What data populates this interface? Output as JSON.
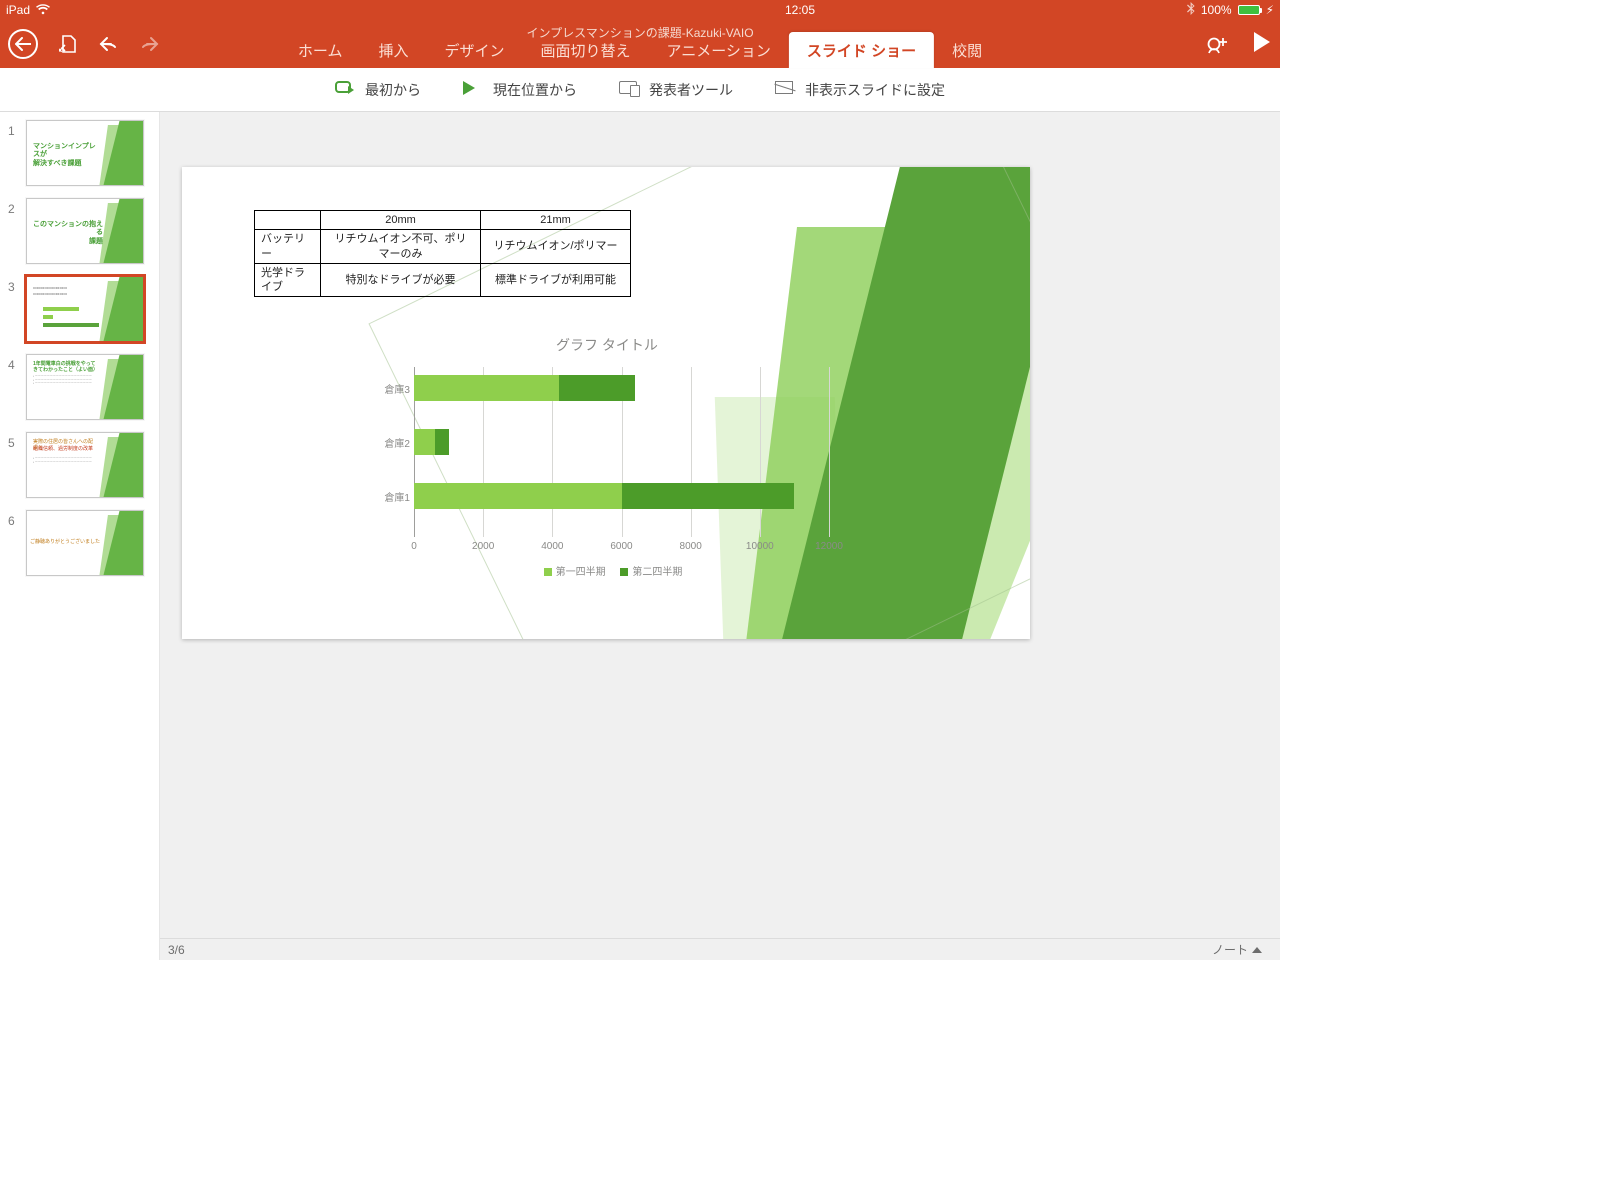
{
  "status": {
    "device": "iPad",
    "time": "12:05",
    "battery": "100%"
  },
  "doc_title": "インプレスマンションの課題-Kazuki-VAIO",
  "tabs": {
    "home": "ホーム",
    "insert": "挿入",
    "design": "デザイン",
    "trans": "画面切り替え",
    "anim": "アニメーション",
    "show": "スライド ショー",
    "review": "校閲"
  },
  "ribbon": {
    "from_start": "最初から",
    "from_current": "現在位置から",
    "presenter": "発表者ツール",
    "hide_slide": "非表示スライドに設定"
  },
  "thumbs": {
    "t1": "マンションインプレスが\n解決すべき課題",
    "t2": "このマンションの抱える\n課題",
    "t4": "1年間電車白の挑戦をやってきてわかったこと（よい面）",
    "t5a": "実際の住居の皆さんへの配慮と",
    "t5b": "組織信頼、過労制度の改革",
    "t6": "ご静聴ありがとうございました"
  },
  "table": {
    "h_col1": "20mm",
    "h_col2": "21mm",
    "r1_h": "バッテリー",
    "r1_c1": "リチウムイオン不可、ポリマーのみ",
    "r1_c2": "リチウムイオン/ポリマー",
    "r2_h": "光学ドライブ",
    "r2_c1": "特別なドライブが必要",
    "r2_c2": "標準ドライブが利用可能"
  },
  "chart_data": {
    "type": "bar",
    "orientation": "horizontal",
    "stacked": true,
    "title": "グラフ タイトル",
    "categories": [
      "倉庫3",
      "倉庫2",
      "倉庫1"
    ],
    "series": [
      {
        "name": "第一四半期",
        "values": [
          4200,
          600,
          6000
        ]
      },
      {
        "name": "第二四半期",
        "values": [
          2200,
          400,
          5000
        ]
      }
    ],
    "xlim": [
      0,
      12000
    ],
    "xticks": [
      0,
      2000,
      4000,
      6000,
      8000,
      10000,
      12000
    ],
    "xticklabels": [
      "0",
      "2000",
      "4000",
      "6000",
      "8000",
      "10000",
      "12000"
    ]
  },
  "footer": {
    "counter": "3/6",
    "notes": "ノート"
  }
}
